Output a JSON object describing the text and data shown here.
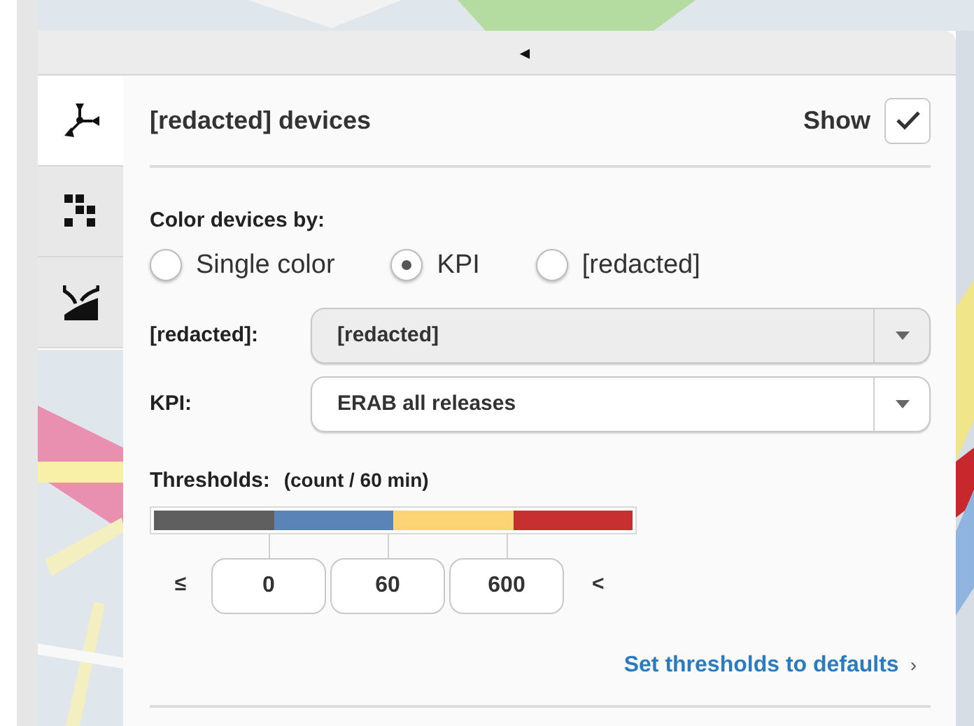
{
  "collapse_bar": {
    "icon": "◄"
  },
  "side_tabs": [
    {
      "kind": "devices",
      "selected": true
    },
    {
      "kind": "grid",
      "selected": false
    },
    {
      "kind": "area",
      "selected": false
    }
  ],
  "header": {
    "title": "[redacted] devices",
    "show_label": "Show",
    "show_checked": true
  },
  "color_by": {
    "label": "Color devices by:",
    "options": [
      {
        "label": "Single color",
        "selected": false
      },
      {
        "label": "KPI",
        "selected": true
      },
      {
        "label": "[redacted]",
        "selected": false
      }
    ]
  },
  "fields": [
    {
      "label": "[redacted]:",
      "value": "[redacted]",
      "disabled": true
    },
    {
      "label": "KPI:",
      "value": "ERAB all releases",
      "disabled": false
    }
  ],
  "thresholds": {
    "label": "Thresholds:",
    "unit": "(count / 60 min)",
    "segments": [
      {
        "color": "#5f5f5f"
      },
      {
        "color": "#5a84b8"
      },
      {
        "color": "#fdd474"
      },
      {
        "color": "#c63031"
      }
    ],
    "lower_sign": "≤",
    "values": [
      "0",
      "60",
      "600"
    ],
    "upper_sign": "<",
    "reset_link": "Set thresholds to defaults",
    "reset_icon": "›"
  }
}
